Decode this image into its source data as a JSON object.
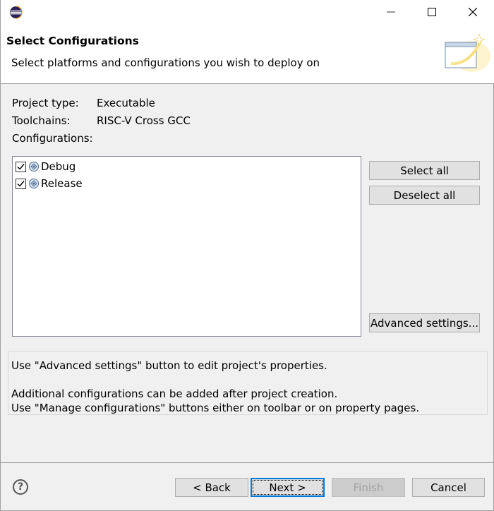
{
  "window": {
    "controls": {
      "minimize": "minimize-icon",
      "maximize": "maximize-icon",
      "close": "close-icon"
    }
  },
  "header": {
    "title": "Select Configurations",
    "description": "Select platforms and configurations you wish to deploy on"
  },
  "project": {
    "type_label": "Project type:",
    "type_value": "Executable",
    "toolchains_label": "Toolchains:",
    "toolchains_value": "RISC-V Cross GCC",
    "configurations_label": "Configurations:"
  },
  "configurations": [
    {
      "name": "Debug",
      "checked": true
    },
    {
      "name": "Release",
      "checked": true
    }
  ],
  "side_buttons": {
    "select_all": "Select all",
    "deselect_all": "Deselect all",
    "advanced": "Advanced settings..."
  },
  "info": {
    "line1": "Use \"Advanced settings\" button to edit project's properties.",
    "line2": "Additional configurations can be added after project creation.",
    "line3": "Use \"Manage configurations\" buttons either on toolbar or on property pages."
  },
  "footer": {
    "help": "?",
    "back": "< Back",
    "next": "Next >",
    "finish": "Finish",
    "cancel": "Cancel"
  },
  "colors": {
    "accent": "#0078d7",
    "window_bg": "#f0f0f0",
    "banner_bg": "#ffffff"
  }
}
